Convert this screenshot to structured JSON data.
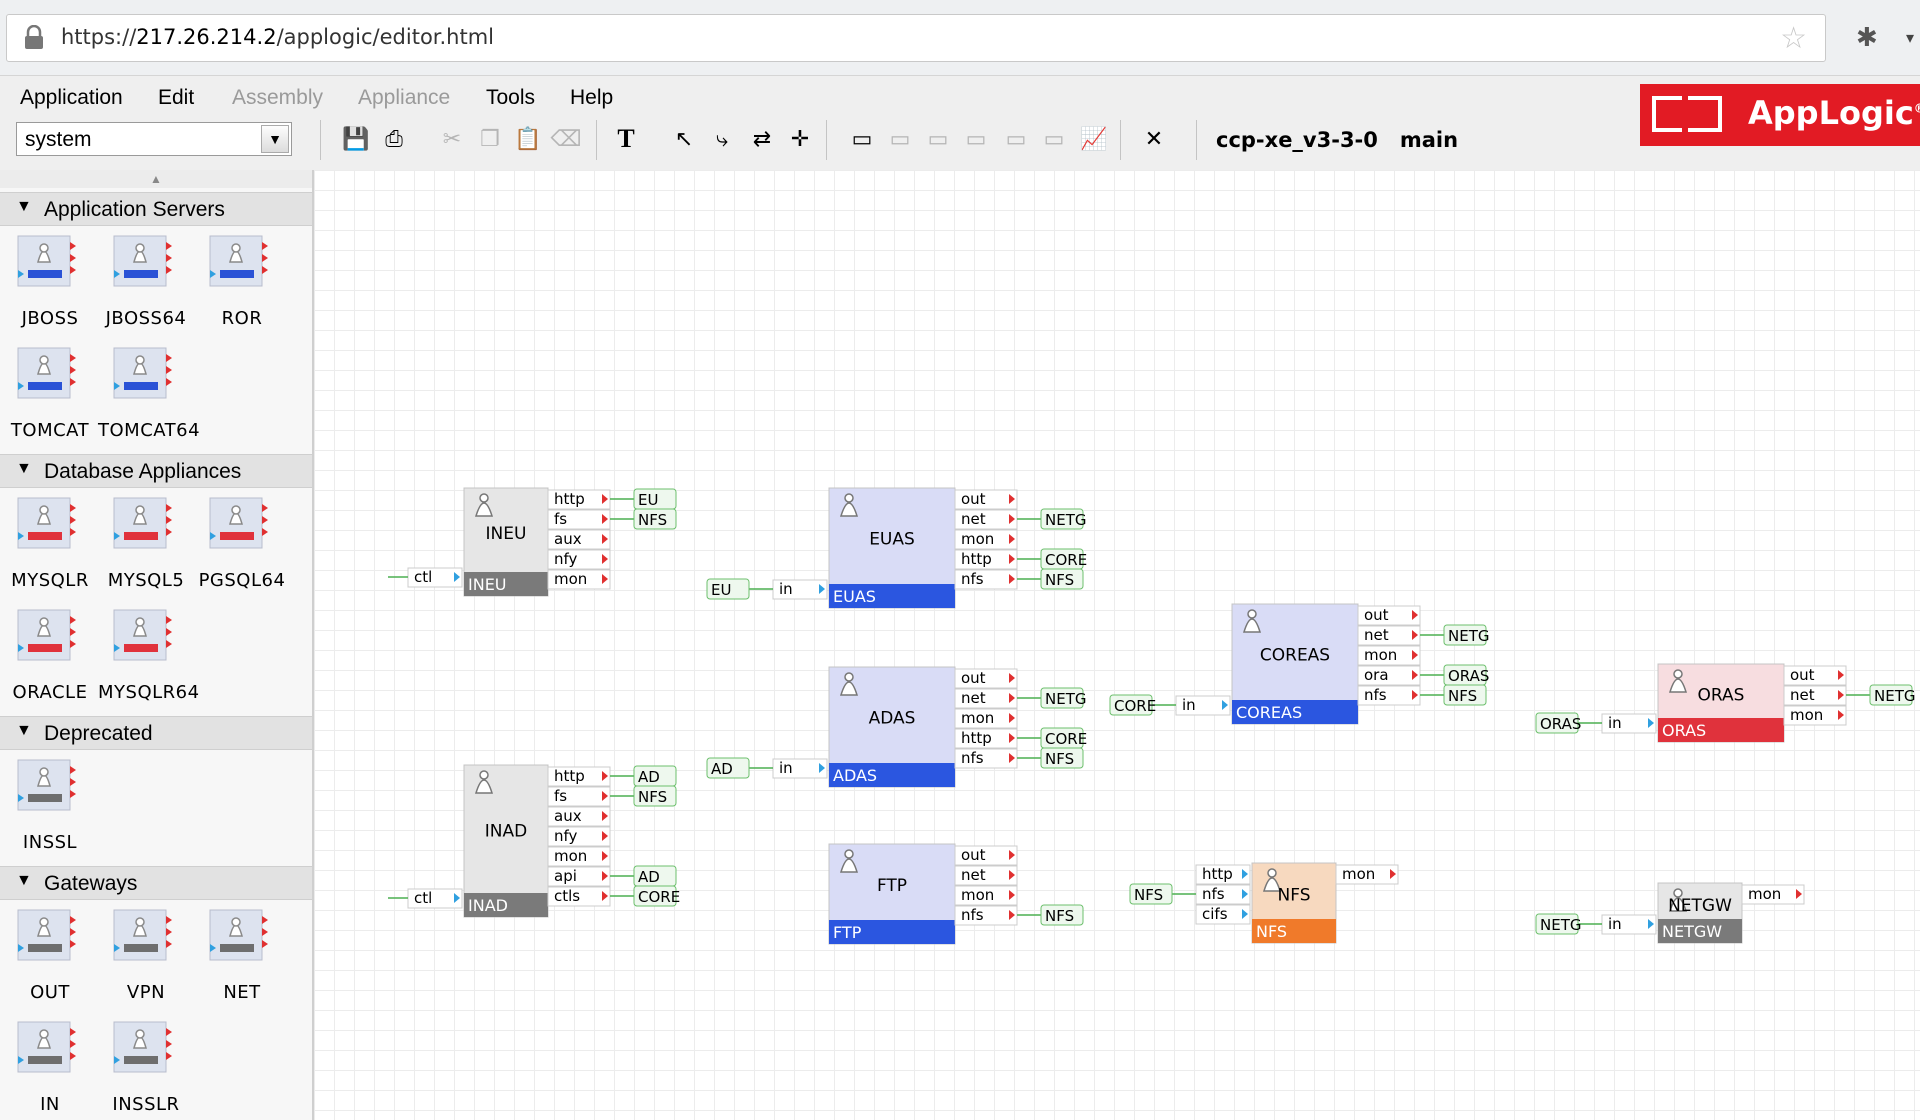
{
  "browser": {
    "url_prefix": "https://",
    "url_host": "217.26.214.2",
    "url_path": "/applogic/editor.html"
  },
  "menu": {
    "items": [
      {
        "label": "Application",
        "enabled": true
      },
      {
        "label": "Edit",
        "enabled": true
      },
      {
        "label": "Assembly",
        "enabled": false
      },
      {
        "label": "Appliance",
        "enabled": false
      },
      {
        "label": "Tools",
        "enabled": true
      },
      {
        "label": "Help",
        "enabled": true
      }
    ]
  },
  "toolbar": {
    "catalog_value": "system",
    "assembly_name": "ccp-xe_v3-3-0",
    "assembly_class": "main",
    "buttons": [
      {
        "icon": "save-icon",
        "enabled": true
      },
      {
        "icon": "print-icon",
        "enabled": true
      },
      {
        "icon": "cut-icon",
        "enabled": false
      },
      {
        "icon": "copy-icon",
        "enabled": false
      },
      {
        "icon": "paste-icon",
        "enabled": false
      },
      {
        "icon": "delete-icon",
        "enabled": false
      },
      {
        "icon": "text-icon",
        "enabled": true
      },
      {
        "icon": "select-pointer-icon",
        "enabled": true
      },
      {
        "icon": "connect-icon",
        "enabled": true
      },
      {
        "icon": "reroute-icon",
        "enabled": true
      },
      {
        "icon": "move-icon",
        "enabled": true
      },
      {
        "icon": "boundary-icon",
        "enabled": true
      },
      {
        "icon": "window-icon",
        "enabled": false
      },
      {
        "icon": "window-icon",
        "enabled": false
      },
      {
        "icon": "window-icon",
        "enabled": false
      },
      {
        "icon": "window-icon",
        "enabled": false
      },
      {
        "icon": "window-icon",
        "enabled": false
      },
      {
        "icon": "monitor-icon",
        "enabled": true
      },
      {
        "icon": "close-icon",
        "enabled": true
      }
    ]
  },
  "logo": {
    "text": "AppLogic",
    "mark": "®"
  },
  "palette": {
    "categories": [
      {
        "label": "Application Servers",
        "items": [
          {
            "name": "JBOSS",
            "color": "#2a52d6"
          },
          {
            "name": "JBOSS64",
            "color": "#2a52d6"
          },
          {
            "name": "ROR",
            "color": "#2a52d6"
          },
          {
            "name": "TOMCAT",
            "color": "#2a52d6"
          },
          {
            "name": "TOMCAT64",
            "color": "#2a52d6"
          }
        ]
      },
      {
        "label": "Database Appliances",
        "items": [
          {
            "name": "MYSQLR",
            "color": "#e0323c"
          },
          {
            "name": "MYSQL5",
            "color": "#e0323c"
          },
          {
            "name": "PGSQL64",
            "color": "#e0323c"
          },
          {
            "name": "ORACLE",
            "color": "#e0323c"
          },
          {
            "name": "MYSQLR64",
            "color": "#e0323c"
          }
        ]
      },
      {
        "label": "Deprecated",
        "items": [
          {
            "name": "INSSL",
            "color": "#6e6e6e"
          }
        ]
      },
      {
        "label": "Gateways",
        "items": [
          {
            "name": "OUT",
            "color": "#6e6e6e"
          },
          {
            "name": "VPN",
            "color": "#6e6e6e"
          },
          {
            "name": "NET",
            "color": "#6e6e6e"
          },
          {
            "name": "IN",
            "color": "#6e6e6e"
          },
          {
            "name": "INSSLR",
            "color": "#6e6e6e"
          }
        ]
      }
    ]
  },
  "diagram": {
    "components": [
      {
        "id": "INEU",
        "title": "INEU",
        "label": "INEU",
        "bar_color": "#7a7a7a",
        "body_color": "#e6e6e6",
        "inputs": [
          "ctl"
        ],
        "outputs": [
          "http",
          "fs",
          "aux",
          "nfy",
          "mon"
        ]
      },
      {
        "id": "INAD",
        "title": "INAD",
        "label": "INAD",
        "bar_color": "#7a7a7a",
        "body_color": "#e6e6e6",
        "inputs": [
          "ctl"
        ],
        "outputs": [
          "http",
          "fs",
          "aux",
          "nfy",
          "mon",
          "api",
          "ctls"
        ]
      },
      {
        "id": "EUAS",
        "title": "EUAS",
        "label": "EUAS",
        "bar_color": "#2b56e0",
        "body_color": "#d9dcf6",
        "inputs": [
          "in"
        ],
        "outputs": [
          "out",
          "net",
          "mon",
          "http",
          "nfs"
        ]
      },
      {
        "id": "ADAS",
        "title": "ADAS",
        "label": "ADAS",
        "bar_color": "#2b56e0",
        "body_color": "#d9dcf6",
        "inputs": [
          "in"
        ],
        "outputs": [
          "out",
          "net",
          "mon",
          "http",
          "nfs"
        ]
      },
      {
        "id": "FTP",
        "title": "FTP",
        "label": "FTP",
        "bar_color": "#2b56e0",
        "body_color": "#d9dcf6",
        "inputs": [],
        "outputs": [
          "out",
          "net",
          "mon",
          "nfs"
        ]
      },
      {
        "id": "COREAS",
        "title": "COREAS",
        "label": "COREAS",
        "bar_color": "#2b56e0",
        "body_color": "#d9dcf6",
        "inputs": [
          "in"
        ],
        "outputs": [
          "out",
          "net",
          "mon",
          "ora",
          "nfs"
        ]
      },
      {
        "id": "NFS",
        "title": "NFS",
        "label": "NFS",
        "bar_color": "#f07a2a",
        "body_color": "#f7d9bf",
        "inputs": [
          "http",
          "nfs",
          "cifs"
        ],
        "outputs": [
          "mon"
        ]
      },
      {
        "id": "ORAS",
        "title": "ORAS",
        "label": "ORAS",
        "bar_color": "#e0323c",
        "body_color": "#f7dde0",
        "inputs": [
          "in"
        ],
        "outputs": [
          "out",
          "net",
          "mon"
        ]
      },
      {
        "id": "NETGW",
        "title": "NETGW",
        "label": "NETGW",
        "bar_color": "#7a7a7a",
        "body_color": "#e6e6e6",
        "inputs": [
          "in"
        ],
        "outputs": [
          "mon"
        ]
      }
    ],
    "terminals": [
      "EU",
      "NFS",
      "NETG",
      "CORE",
      "NFS",
      "AD",
      "NFS",
      "NETG",
      "CORE",
      "NFS",
      "AD",
      "CORE",
      "NFS",
      "NETG",
      "ORAS",
      "NFS",
      "NETG",
      "EU",
      "AD",
      "CORE",
      "NFS",
      "ORAS",
      "NETG"
    ]
  }
}
